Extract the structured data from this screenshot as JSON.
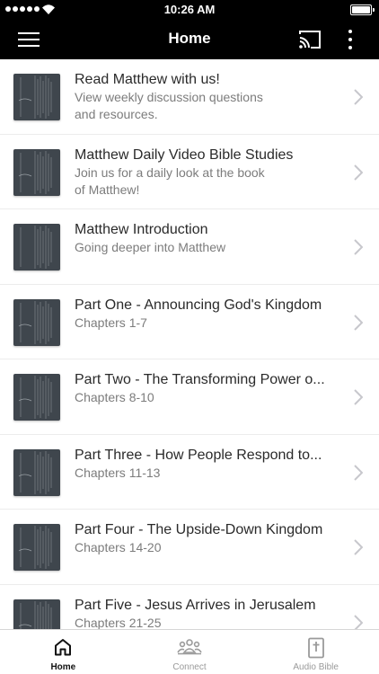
{
  "status_bar": {
    "time": "10:26 AM"
  },
  "header": {
    "title": "Home"
  },
  "items": [
    {
      "title": "Read Matthew with us!",
      "subtitle": "View weekly discussion questions\nand resources."
    },
    {
      "title": "Matthew Daily Video Bible Studies",
      "subtitle": "Join us for a daily look at the book\nof Matthew!"
    },
    {
      "title": "Matthew Introduction",
      "subtitle": "Going deeper into Matthew"
    },
    {
      "title": "Part One - Announcing God's Kingdom",
      "subtitle": "Chapters 1-7"
    },
    {
      "title": "Part Two - The Transforming Power o...",
      "subtitle": "Chapters 8-10"
    },
    {
      "title": "Part Three - How People Respond to...",
      "subtitle": "Chapters 11-13"
    },
    {
      "title": "Part Four - The Upside-Down Kingdom",
      "subtitle": "Chapters 14-20"
    },
    {
      "title": "Part Five - Jesus Arrives in Jerusalem",
      "subtitle": "Chapters 21-25"
    }
  ],
  "tabs": [
    {
      "label": "Home",
      "icon": "home-icon",
      "active": true
    },
    {
      "label": "Connect",
      "icon": "connect-icon",
      "active": false
    },
    {
      "label": "Audio Bible",
      "icon": "audio-bible-icon",
      "active": false
    }
  ],
  "colors": {
    "bar_background": "#000000",
    "thumbnail": "#3f464d",
    "accent_active": "#111111",
    "inactive": "#9a9a9a"
  }
}
